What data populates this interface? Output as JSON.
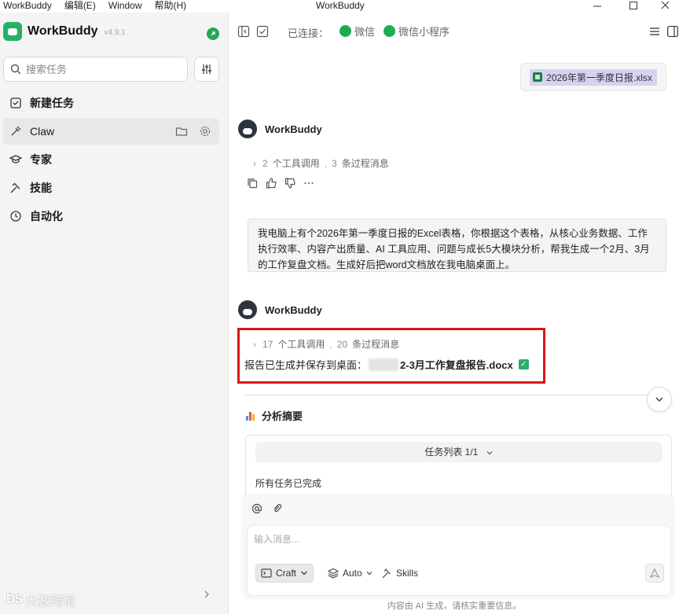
{
  "window": {
    "menu": [
      "WorkBuddy",
      "编辑(E)",
      "Window",
      "帮助(H)"
    ],
    "title": "WorkBuddy",
    "controls": [
      "minimize-icon",
      "maximize-icon",
      "close-icon"
    ]
  },
  "sidebar": {
    "brand_name": "WorkBuddy",
    "version": "v4.9.1",
    "search_placeholder": "搜索任务",
    "items": [
      {
        "label": "新建任务",
        "icon": "new-task-icon"
      },
      {
        "label": "Claw",
        "icon": "claw-icon",
        "active": true
      },
      {
        "label": "专家",
        "icon": "expert-icon"
      },
      {
        "label": "技能",
        "icon": "skill-icon"
      },
      {
        "label": "自动化",
        "icon": "clock-icon"
      }
    ],
    "watermark": "大數跨境",
    "watermark_logo": "DS"
  },
  "topbar": {
    "connected_label": "已连接：",
    "channels": [
      "微信",
      "微信小程序"
    ]
  },
  "chat": {
    "attachment": "2026年第一季度日报.xlsx",
    "agent_name": "WorkBuddy",
    "first_reply": {
      "tool_count": "2",
      "tool_label": "个工具调用",
      "proc_count": "3",
      "proc_label": "条过程消息"
    },
    "user_message": "我电脑上有个2026年第一季度日报的Excel表格，你根据这个表格，从核心业务数据、工作执行效率、内容产出质量、AI 工具应用、问题与成长5大模块分析，帮我生成一个2月、3月的工作复盘文档。生成好后把word文档放在我电脑桌面上。",
    "second_reply": {
      "tool_count": "17",
      "tool_label": "个工具调用",
      "proc_count": "20",
      "proc_label": "条过程消息",
      "saved_prefix": "报告已生成并保存到桌面：",
      "file_name": "2-3月工作复盘报告.docx"
    },
    "summary_title": "分析摘要",
    "task_list_label": "任务列表 1/1",
    "task_status": "所有任务已完成"
  },
  "composer": {
    "placeholder": "输入消息...",
    "mode": "Craft",
    "model": "Auto",
    "skills": "Skills",
    "disclaimer": "内容由 AI 生成，请核实重要信息。"
  },
  "colors": {
    "accent_green": "#25b06a",
    "highlight_red": "#d9161c"
  }
}
